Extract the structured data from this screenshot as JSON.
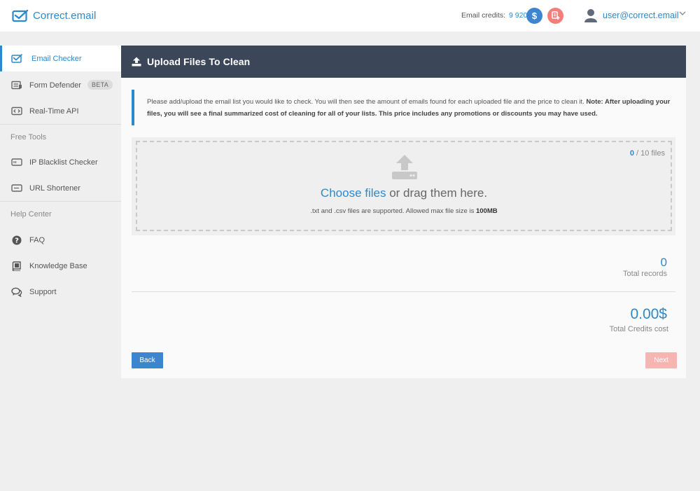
{
  "app": {
    "brand": "Correct.email",
    "brand_color": "#2f88c9"
  },
  "header": {
    "credits_label": "Email credits:",
    "credits_value": "9 920",
    "dollar_icon": "$",
    "user_email": "user@correct.email"
  },
  "sidebar": {
    "items": [
      {
        "label": "Email Checker",
        "icon": "envelope-check-icon",
        "active": true
      },
      {
        "label": "Form Defender",
        "icon": "form-icon",
        "badge": "BETA"
      },
      {
        "label": "Real-Time API",
        "icon": "api-icon"
      }
    ],
    "free_tools_heading": "Free Tools",
    "free_tools": [
      {
        "label": "IP Blacklist Checker",
        "icon": "ip-icon"
      },
      {
        "label": "URL Shortener",
        "icon": "url-icon"
      }
    ],
    "help_heading": "Help Center",
    "help": [
      {
        "label": "FAQ",
        "icon": "question-icon"
      },
      {
        "label": "Knowledge Base",
        "icon": "book-icon"
      },
      {
        "label": "Support",
        "icon": "chat-icon"
      }
    ]
  },
  "main": {
    "title": "Upload Files To Clean",
    "info_text": "Please add/upload the email list you would like to check. You will then see the amount of emails found for each uploaded file and the price to clean it.",
    "info_bold": "Note: After uploading your files, you will see a final summarized cost of cleaning for all of your lists. This price includes any promotions or discounts you may have used.",
    "file_count_current": "0",
    "file_count_rest": "/ 10 files",
    "choose_link": "Choose files",
    "choose_rest": "or drag them here.",
    "support_text": ".txt and .csv files are supported. Allowed max file size is",
    "support_max": "100MB",
    "total_records_value": "0",
    "total_records_label": "Total records",
    "total_credits_value": "0.00$",
    "total_credits_label": "Total Credits cost",
    "back_label": "Back",
    "next_label": "Next"
  }
}
